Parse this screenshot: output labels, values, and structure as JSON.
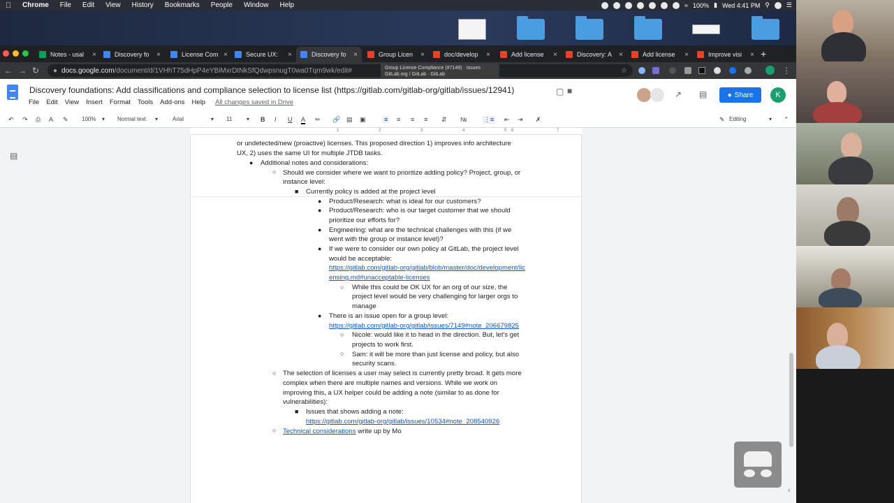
{
  "menubar": {
    "app": "Chrome",
    "items": [
      "File",
      "Edit",
      "View",
      "History",
      "Bookmarks",
      "People",
      "Window",
      "Help"
    ],
    "battery": "100%",
    "clock": "Wed 4:41 PM"
  },
  "tabs": [
    {
      "label": "Notes - usal",
      "color": "#0f9d58"
    },
    {
      "label": "Discovery fo",
      "color": "#4285f4"
    },
    {
      "label": "License Com",
      "color": "#4285f4"
    },
    {
      "label": "Secure UX:",
      "color": "#4285f4"
    },
    {
      "label": "Discovery fo",
      "color": "#4285f4"
    },
    {
      "label": "Group Licen",
      "color": "#e24329"
    },
    {
      "label": "doc/develop",
      "color": "#e24329"
    },
    {
      "label": "Add license",
      "color": "#e24329"
    },
    {
      "label": "Discovery: A",
      "color": "#e24329"
    },
    {
      "label": "Add license",
      "color": "#e24329"
    },
    {
      "label": "Improve visi",
      "color": "#e24329"
    }
  ],
  "address": {
    "host": "docs.google.com",
    "path": "/document/d/1VHhT75dHpP4eYBiMxrDtNkSfQdwpsnugT0wa0Tqm9wk/edit#"
  },
  "tooltip": {
    "line1": "Group License Compliance (#7149) · Issues ·",
    "line2": "GitLab.org / GitLab · GitLab"
  },
  "doc": {
    "title": "Discovery foundations: Add classifications and compliance selection to license list (https://gitlab.com/gitlab-org/gitlab/issues/12941)",
    "menu": [
      "File",
      "Edit",
      "View",
      "Insert",
      "Format",
      "Tools",
      "Add-ons",
      "Help"
    ],
    "saved": "All changes saved in Drive",
    "share": "Share",
    "avatar": "K"
  },
  "toolbar": {
    "zoom": "100%",
    "style": "Normal text",
    "font": "Arial",
    "size": "11",
    "mode": "Editing",
    "bold": "B",
    "italic": "I",
    "underline": "U",
    "color": "A"
  },
  "content": {
    "l0": "or undetected/new (proactive) licenses. This proposed direction 1) improves info architecture",
    "l1": "UX,  2) uses the same UI for multiple JTDB tasks.",
    "l2": "Additional notes and considerations:",
    "l3": "Should we consider where we want to prioritize adding policy? Project, group, or",
    "l4": "instance level:",
    "l5": "Currently policy is added at the project level",
    "l6": "Product/Research: what is ideal for our customers?",
    "l7": "Product/Research: who is our target customer that we should",
    "l8": "prioritize our efforts for?",
    "l9": "Engineering: what are the technical challenges with this (if we",
    "l10": "went with the group or instance level)?",
    "l11": "If we were to consider our own policy at GitLab, the project level",
    "l12": "would be acceptable:",
    "l13": "https://gitlab.com/gitlab-org/gitlab/blob/master/doc/development/lic",
    "l14": "ensing.md#unacceptable-licenses",
    "l15": "While this could be OK UX for an org of our size, the",
    "l16": "project level would be very challenging for larger orgs to",
    "l17": "manage",
    "l18": "There is an issue open for a group level:",
    "l19": "https://gitlab.com/gitlab-org/gitlab/issues/7149#note_206679825",
    "l20": "Nicole: would like it to head in the direction. But, let's get",
    "l21": "projects to work first.",
    "l22": "Sam: it will be more than just license and policy, but also",
    "l23": "security scans.",
    "l24": "The selection of licenses a user may select is currently pretty broad. It gets more",
    "l25": "complex when there are multiple names and versions. While we work on",
    "l26": "improving this, a UX helper could be adding a note (similar to as done for",
    "l27": "vulnerabilities):",
    "l28": "Issues that shows adding a note:",
    "l29": "https://gitlab.com/gitlab-org/gitlab/issues/10534#note_208540926",
    "l30a": "Technical considerations",
    "l30b": " write up by Mo"
  }
}
